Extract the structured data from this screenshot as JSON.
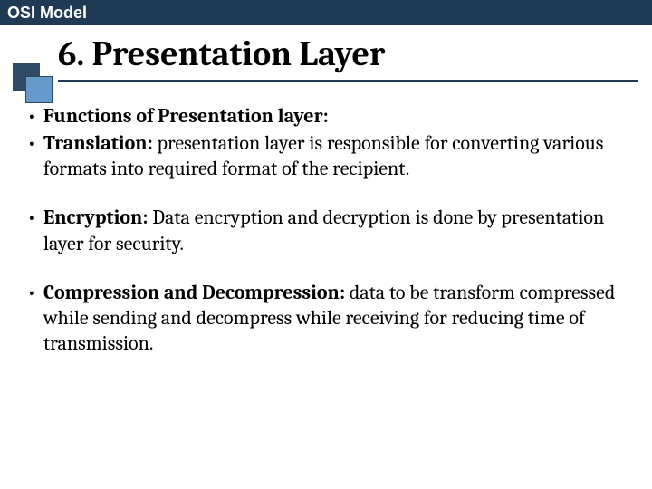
{
  "header": {
    "title": "OSI Model"
  },
  "slide": {
    "title": "6. Presentation Layer",
    "bullets": [
      {
        "bold": "Functions of Presentation layer:",
        "rest": ""
      },
      {
        "bold": "Translation:",
        "rest": " presentation layer is responsible for converting various formats into required format of the recipient."
      },
      {
        "bold": "Encryption:",
        "rest": " Data encryption and decryption is done by presentation layer for security."
      },
      {
        "bold": "Compression and Decompression:",
        "rest": " data to be transform compressed while sending and decompress while receiving for reducing time of transmission."
      }
    ]
  }
}
